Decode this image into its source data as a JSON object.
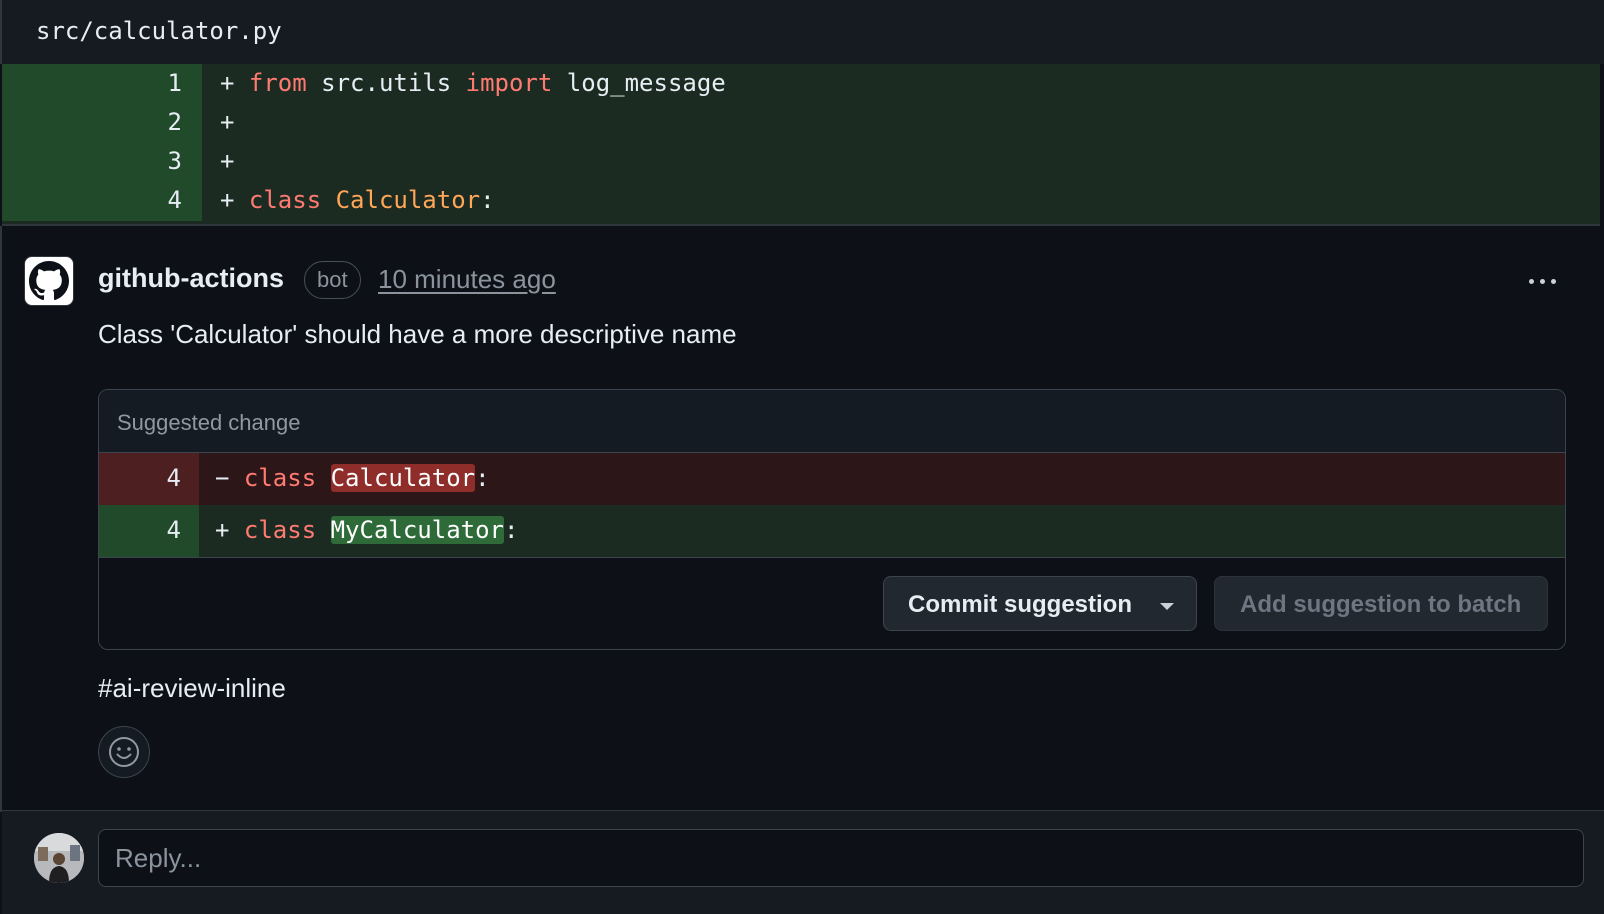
{
  "file": {
    "path": "src/calculator.py"
  },
  "diff_lines": [
    {
      "number": "1",
      "sign": "+",
      "kw1": "from",
      "t1": " src.utils ",
      "kw2": "import",
      "t2": " log_message"
    },
    {
      "number": "2",
      "sign": "+"
    },
    {
      "number": "3",
      "sign": "+"
    },
    {
      "number": "4",
      "sign": "+",
      "kw1": "class",
      "cls": "Calculator",
      "t2": ":"
    }
  ],
  "comment": {
    "author": "github-actions",
    "badge": "bot",
    "timestamp": "10 minutes ago",
    "body": "Class 'Calculator' should have a more descriptive name",
    "tag": "#ai-review-inline"
  },
  "suggestion": {
    "title": "Suggested change",
    "removed": {
      "number": "4",
      "sign": "−",
      "kw": "class",
      "name": "Calculator",
      "suffix": ":"
    },
    "added": {
      "number": "4",
      "sign": "+",
      "kw": "class",
      "name": "MyCalculator",
      "suffix": ":"
    },
    "commit_label": "Commit suggestion",
    "batch_label": "Add suggestion to batch"
  },
  "reply": {
    "placeholder": "Reply..."
  },
  "colors": {
    "added_bg": "#1b2b22",
    "removed_bg": "#2d1618",
    "keyword": "#ff7b72",
    "class_name": "#ffa657"
  }
}
